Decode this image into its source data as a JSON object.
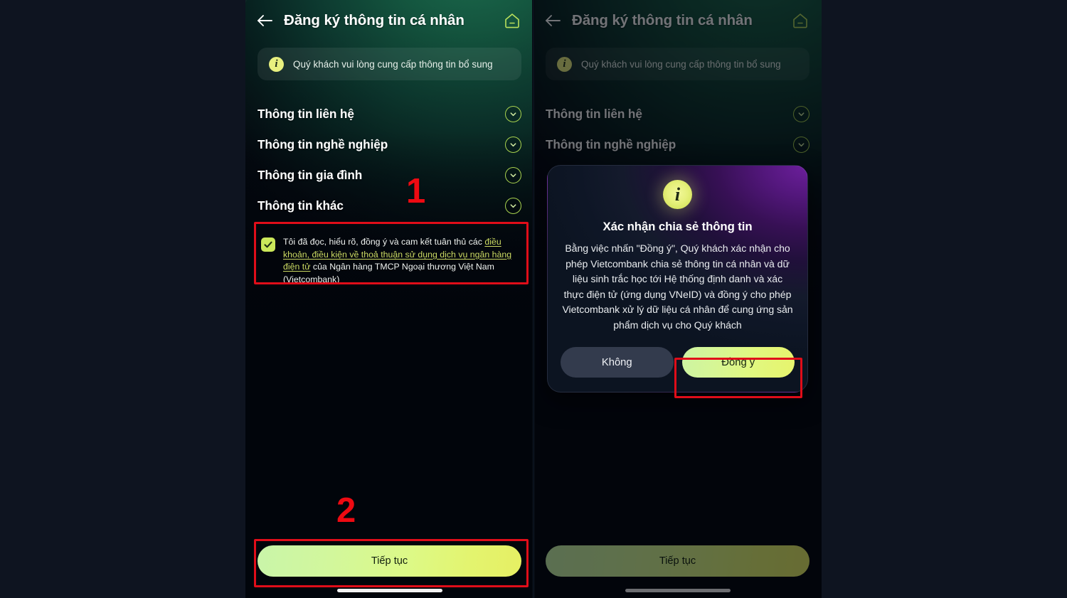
{
  "screen": {
    "title": "Đăng ký thông tin cá nhân",
    "back_icon": "back-arrow-icon",
    "home_icon": "home-outline-icon",
    "info_banner": {
      "icon": "info-circle-icon",
      "icon_glyph": "i",
      "text": "Quý khách vui lòng cung cấp thông tin bổ sung"
    },
    "sections": [
      {
        "label": "Thông tin liên hệ",
        "chevron": "chevron-down-icon"
      },
      {
        "label": "Thông tin nghề nghiệp",
        "chevron": "chevron-down-icon"
      },
      {
        "label": "Thông tin gia đình",
        "chevron": "chevron-down-icon"
      },
      {
        "label": "Thông tin khác",
        "chevron": "chevron-down-icon"
      }
    ],
    "consent": {
      "checked": true,
      "check_icon": "checkmark-icon",
      "text_before": "Tôi đã đọc, hiểu rõ, đồng ý và cam kết tuân thủ các ",
      "link_text": "điều khoản, điều kiện về thoả thuận sử dụng dịch vụ ngân hàng điện tử",
      "text_after": " của Ngân hàng TMCP Ngoại thương Việt Nam (Vietcombank)"
    },
    "cta_label": "Tiếp tục"
  },
  "dialog": {
    "icon": "info-circle-icon",
    "icon_glyph": "i",
    "title": "Xác nhận chia sẻ thông tin",
    "body": "Bằng việc nhấn \"Đồng ý\", Quý khách xác nhận cho phép Vietcombank chia sẻ thông tin cá nhân và dữ liệu sinh trắc học tới Hệ thống định danh và xác thực điện tử (ứng dụng VNeID) và đồng ý cho phép Vietcombank xử lý dữ liệu cá nhân để cung ứng sản phẩm dịch vụ cho Quý khách",
    "decline_label": "Không",
    "accept_label": "Đồng ý"
  },
  "annotations": {
    "step_one": "1",
    "step_two": "2",
    "highlight_color": "#e00d19"
  },
  "palette": {
    "accent_lime": "#d9ef7a",
    "cta_gradient_start": "#c9f5a9",
    "cta_gradient_end": "#e6ef63",
    "header_green": "#14563f",
    "page_background": "#0e1420",
    "dialog_purple": "#6c1f9c"
  }
}
